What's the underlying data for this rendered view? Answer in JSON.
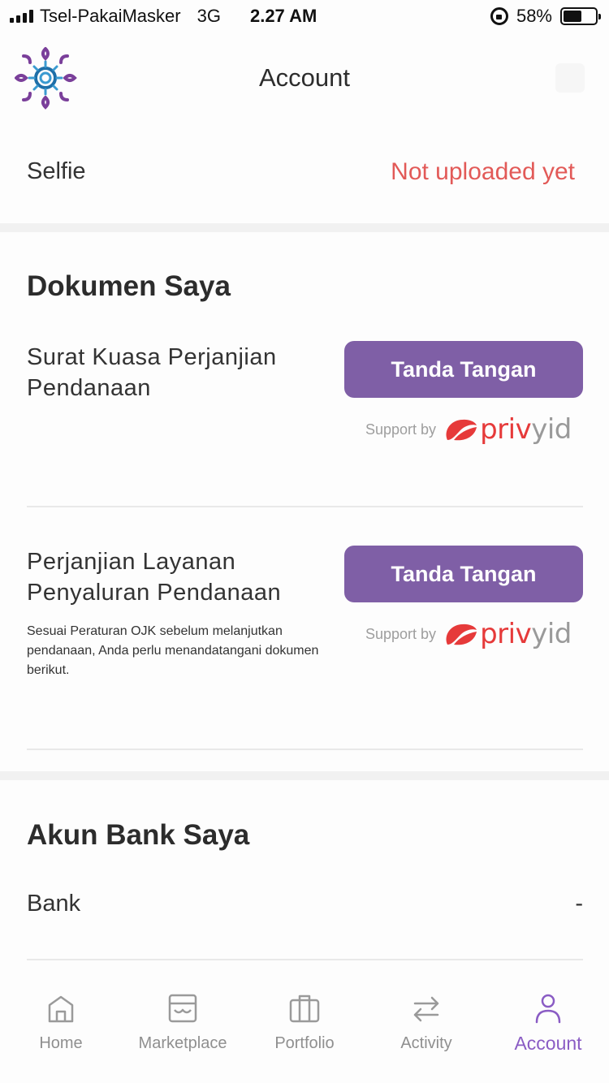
{
  "status_bar": {
    "carrier": "Tsel-PakaiMasker",
    "network": "3G",
    "time": "2.27 AM",
    "battery": "58%",
    "battery_level": 0.58
  },
  "header": {
    "title": "Account"
  },
  "selfie": {
    "label": "Selfie",
    "status": "Not uploaded yet",
    "status_color": "#e25a58"
  },
  "documents": {
    "title": "Dokumen Saya",
    "items": [
      {
        "title": "Surat Kuasa Perjanjian Pendanaan",
        "button_label": "Tanda Tangan",
        "support_label": "Support by",
        "provider": "privyid"
      },
      {
        "title": "Perjanjian Layanan Penyaluran Pendanaan",
        "note": "Sesuai Peraturan OJK sebelum melanjutkan pendanaan, Anda perlu menandatangani dokumen berikut.",
        "button_label": "Tanda Tangan",
        "support_label": "Support by",
        "provider": "privyid"
      }
    ]
  },
  "bank": {
    "title": "Akun Bank Saya",
    "label": "Bank",
    "value": "-"
  },
  "tabs": [
    {
      "label": "Home",
      "icon": "home-icon",
      "active": false
    },
    {
      "label": "Marketplace",
      "icon": "marketplace-icon",
      "active": false
    },
    {
      "label": "Portfolio",
      "icon": "briefcase-icon",
      "active": false
    },
    {
      "label": "Activity",
      "icon": "swap-arrows-icon",
      "active": false
    },
    {
      "label": "Account",
      "icon": "user-icon",
      "active": true
    }
  ],
  "colors": {
    "accent": "#7f5fa6",
    "active_tab": "#8a5cc4",
    "inactive_tab": "#8f8f8f",
    "privy_red": "#e63a3a"
  }
}
